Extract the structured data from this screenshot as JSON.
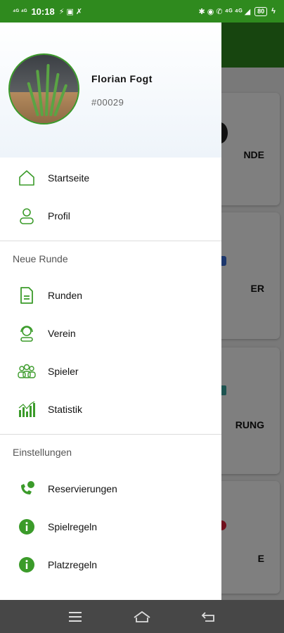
{
  "status_bar": {
    "time": "10:18",
    "left_glyphs": "⁴ᴳ ⁴ᴳ",
    "battery": "80"
  },
  "background": {
    "cards": [
      {
        "label": "NDE",
        "color": "#222222"
      },
      {
        "label": "ER",
        "color": "#3a6fd8"
      },
      {
        "label": "RUNG",
        "color": "#3aa6a0"
      },
      {
        "label": "E",
        "color": "#e0203a"
      }
    ]
  },
  "drawer": {
    "user": {
      "name": "Florian Fogt",
      "id": "#00029"
    },
    "items_top": [
      {
        "label": "Startseite",
        "icon": "home-icon"
      },
      {
        "label": "Profil",
        "icon": "person-icon"
      }
    ],
    "section_new_round": {
      "title": "Neue Runde",
      "items": [
        {
          "label": "Runden",
          "icon": "document-icon"
        },
        {
          "label": "Verein",
          "icon": "support-agent-icon"
        },
        {
          "label": "Spieler",
          "icon": "group-icon"
        },
        {
          "label": "Statistik",
          "icon": "bar-chart-icon"
        }
      ]
    },
    "section_settings": {
      "title": "Einstellungen",
      "items": [
        {
          "label": "Reservierungen",
          "icon": "phone-icon"
        },
        {
          "label": "Spielregeln",
          "icon": "info-icon"
        },
        {
          "label": "Platzregeln",
          "icon": "info-icon"
        }
      ]
    }
  },
  "colors": {
    "brand_green": "#2f8a1e",
    "icon_green": "#3b9b2a"
  },
  "nav_bar": {
    "menu": "menu-icon",
    "home": "home-outline-icon",
    "back": "back-icon"
  }
}
